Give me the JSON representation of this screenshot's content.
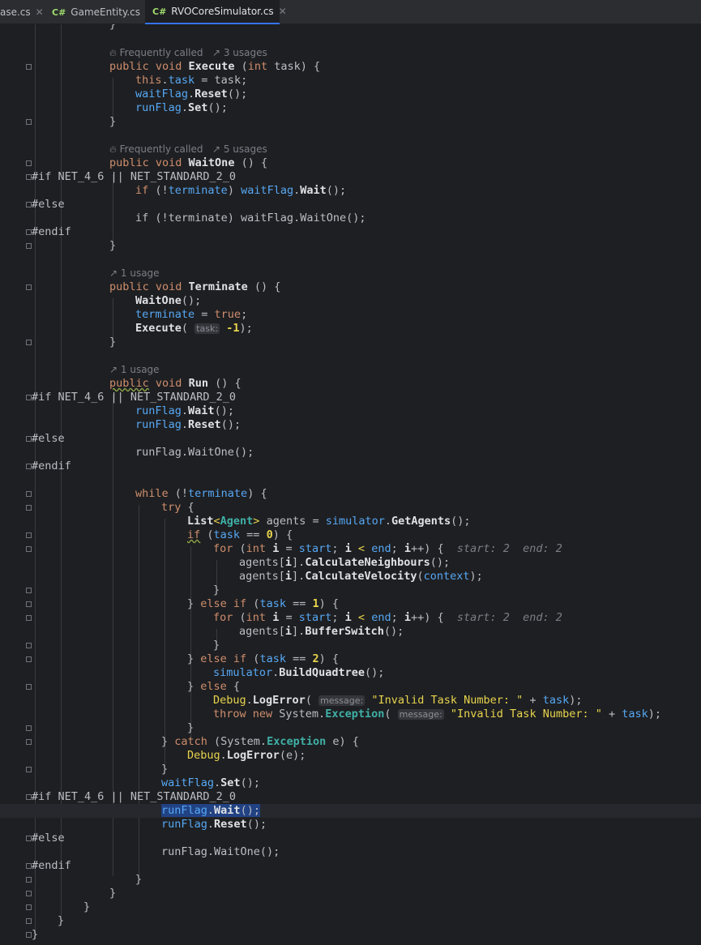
{
  "tabs": [
    {
      "label": "ase.cs",
      "close": "✕"
    },
    {
      "label": "GameEntity.cs",
      "lang": "C#",
      "close": "✕"
    },
    {
      "label": "RVOCoreSimulator.cs",
      "lang": "C#",
      "close": "✕",
      "active": true
    }
  ],
  "lenses": {
    "execute": {
      "hint": "Frequently called",
      "usages": "3 usages"
    },
    "waitone": {
      "hint": "Frequently called",
      "usages": "5 usages"
    },
    "terminate": {
      "usages": "1 usage"
    },
    "run": {
      "usages": "1 usage"
    }
  },
  "code": {
    "l0": "            }",
    "execute_sig": "public void Execute (int task) {",
    "execute_1": "this.task = task;",
    "execute_2": "waitFlag.Reset();",
    "execute_3": "runFlag.Set();",
    "close_brace": "}",
    "waitone_sig": "public void WaitOne () {",
    "if_net": "#if NET_4_6 || NET_STANDARD_2_0",
    "waitone_1": "if (!terminate) waitFlag.Wait();",
    "else": "#else",
    "waitone_2": "if (!terminate) waitFlag.WaitOne();",
    "endif": "#endif",
    "terminate_sig": "public void Terminate () {",
    "terminate_1": "WaitOne();",
    "terminate_2": "terminate = true;",
    "terminate_3a": "Execute(",
    "hint_task": "task:",
    "terminate_3b": "-1);",
    "run_sig": "public void Run () {",
    "run_1": "runFlag.Wait();",
    "run_2": "runFlag.Reset();",
    "run_3": "runFlag.WaitOne();",
    "while": "while (!terminate) {",
    "try": "try {",
    "agents": "List<Agent> agents = simulator.GetAgents();",
    "if0": "if (task == 0) {",
    "for1": "for (int i = start; i < end; i++) {",
    "for_hint": "start: 2  end: 2",
    "calc_n": "agents[i].CalculateNeighbours();",
    "calc_v": "agents[i].CalculateVelocity(context);",
    "inner_close": "}",
    "elseif1": "} else if (task == 1) {",
    "buffer": "agents[i].BufferSwitch();",
    "elseif2": "} else if (task == 2) {",
    "quad": "simulator.BuildQuadtree();",
    "else_b": "} else {",
    "log1a": "Debug.LogError(",
    "hint_msg": "message:",
    "log1b": "\"Invalid Task Number: \" + task);",
    "throw_a": "throw new System.Exception(",
    "catch": "} catch (System.Exception e) {",
    "log2": "Debug.LogError(e);",
    "waitset": "waitFlag.Set();"
  }
}
